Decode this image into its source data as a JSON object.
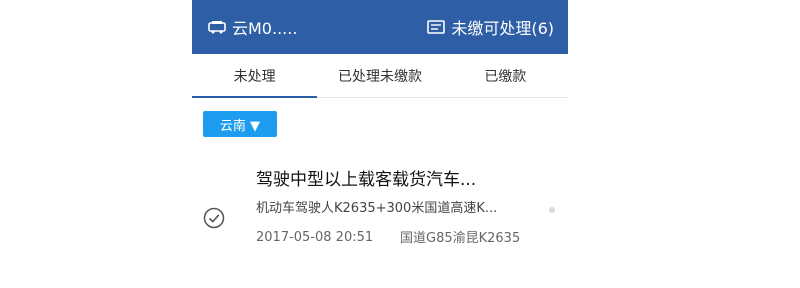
{
  "header": {
    "plate": "云M0.....",
    "pending_label": "未缴可处理(6)"
  },
  "tabs": [
    {
      "label": "未处理",
      "active": true
    },
    {
      "label": "已处理未缴款",
      "active": false
    },
    {
      "label": "已缴款",
      "active": false
    }
  ],
  "filter": {
    "label": "云南 ▼",
    "color": "#1e9cf0"
  },
  "violation": {
    "title": "驾驶中型以上载客载货汽车...",
    "subtitle": "机动车驾驶人K2635+300米国道高速K...",
    "time": "2017-05-08 20:51",
    "place": "国道G85渝昆K2635",
    "checked": true
  },
  "colors": {
    "header_bg": "#2d5ea6",
    "accent": "#1e9cf0"
  }
}
